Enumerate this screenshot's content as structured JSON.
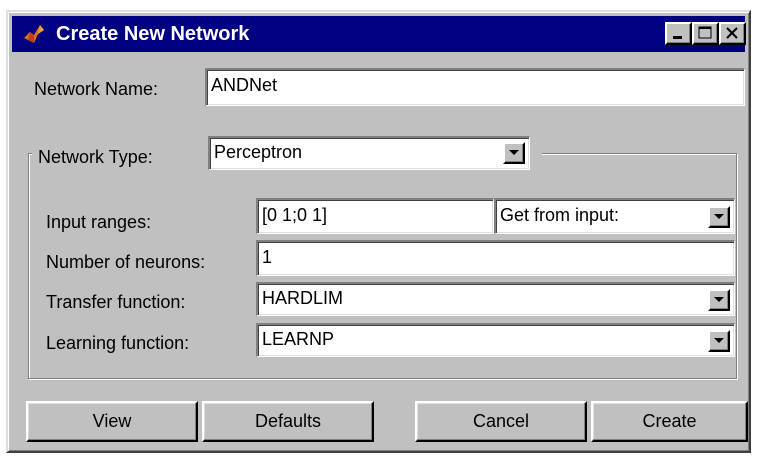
{
  "window": {
    "title": "Create New Network",
    "icon": "matlab-membrane-icon",
    "controls": [
      "minimize-icon",
      "maximize-icon",
      "close-icon"
    ]
  },
  "network_name": {
    "label": "Network Name:",
    "value": "ANDNet"
  },
  "network_type": {
    "label": "Network Type:",
    "value": "Perceptron"
  },
  "input_ranges": {
    "label": "Input ranges:",
    "value": "[0 1;0 1]",
    "source_value": "Get from input:"
  },
  "num_neurons": {
    "label": "Number of neurons:",
    "value": "1"
  },
  "transfer_function": {
    "label": "Transfer function:",
    "value": "HARDLIM"
  },
  "learning_function": {
    "label": "Learning function:",
    "value": "LEARNP"
  },
  "buttons": {
    "view": "View",
    "defaults": "Defaults",
    "cancel": "Cancel",
    "create": "Create"
  },
  "colors": {
    "titlebar": "#000080",
    "face": "#c0c0c0",
    "field": "#ffffff"
  }
}
